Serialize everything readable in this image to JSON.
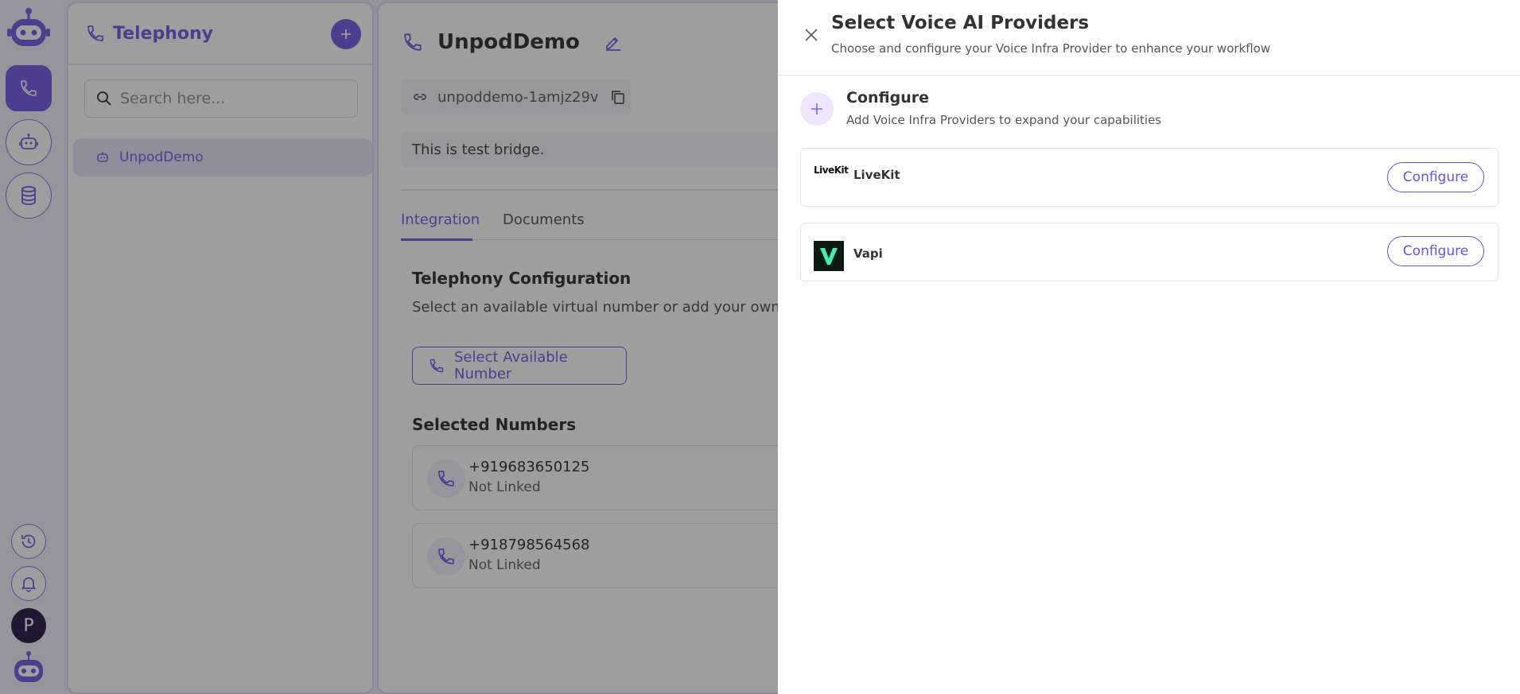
{
  "rail": {
    "avatar_letter": "P"
  },
  "sidebar": {
    "title": "Telephony",
    "search": {
      "placeholder": "Search here..."
    },
    "items": [
      {
        "label": "UnpodDemo"
      }
    ]
  },
  "main": {
    "title": "UnpodDemo",
    "slug": "unpoddemo-1amjz29v",
    "description": "This is test bridge.",
    "tabs": [
      {
        "label": "Integration",
        "active": true
      },
      {
        "label": "Documents",
        "active": false
      }
    ],
    "telephony": {
      "title": "Telephony Configuration",
      "subtitle": "Select an available virtual number or add your own SIP tr",
      "select_button": "Select Available Number"
    },
    "selected_numbers": {
      "title": "Selected Numbers",
      "items": [
        {
          "number": "+919683650125",
          "status": "Not Linked"
        },
        {
          "number": "+918798564568",
          "status": "Not Linked"
        }
      ]
    }
  },
  "drawer": {
    "title": "Select Voice AI Providers",
    "subtitle": "Choose and configure your Voice Infra Provider to enhance your workflow",
    "configure": {
      "title": "Configure",
      "subtitle": "Add Voice Infra Providers to expand your capabilities"
    },
    "providers": [
      {
        "name": "LiveKit",
        "logo_text": "LiveKit",
        "button": "Configure"
      },
      {
        "name": "Vapi",
        "button": "Configure"
      }
    ]
  },
  "colors": {
    "accent": "#6a4fe4",
    "overlay": "#282828",
    "vapi_green": "#3ef0b0"
  }
}
